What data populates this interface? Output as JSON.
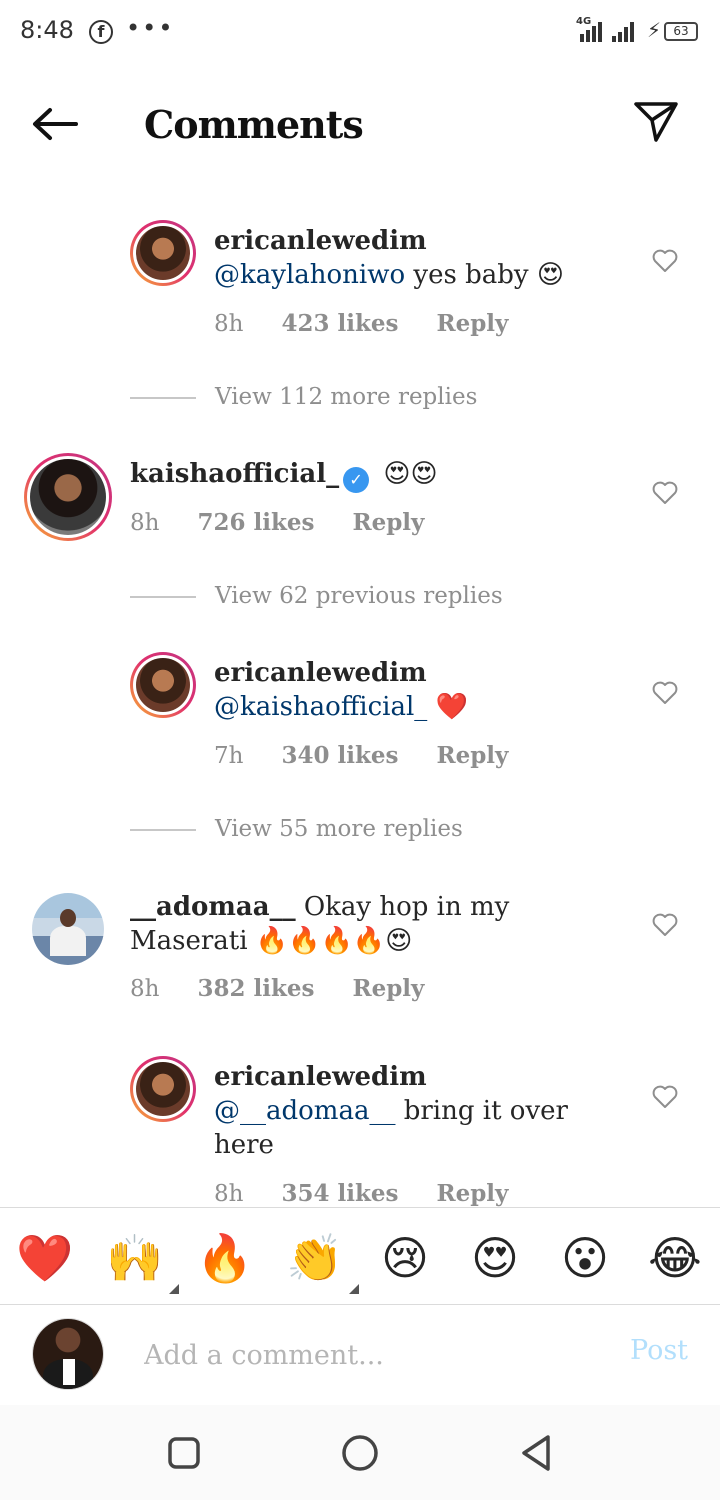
{
  "status_bar": {
    "time": "8:48",
    "network": "4G",
    "battery": "63"
  },
  "header": {
    "title": "Comments"
  },
  "comments": [
    {
      "user": "ericanlewedim",
      "mention": "@kaylahoniwo",
      "text": "yes baby",
      "emoji": "😍",
      "time": "8h",
      "likes": "423 likes",
      "reply": "Reply"
    },
    {
      "view_more": "View 112 more replies"
    },
    {
      "user": "kaishaofficial_",
      "text": "😍😍",
      "time": "8h",
      "likes": "726 likes",
      "reply": "Reply"
    },
    {
      "view_more": "View 62 previous replies"
    },
    {
      "user": "ericanlewedim",
      "mention": "@kaishaofficial_",
      "emoji": "❤️",
      "time": "7h",
      "likes": "340 likes",
      "reply": "Reply"
    },
    {
      "view_more": "View 55 more replies"
    },
    {
      "user": "__adomaa__",
      "text_line1": "Okay hop in my",
      "text_line2": "Maserati",
      "emoji": "🔥🔥🔥🔥😍",
      "time": "8h",
      "likes": "382 likes",
      "reply": "Reply"
    },
    {
      "user": "ericanlewedim",
      "mention": "@__adomaa__",
      "text_line1": "bring it over",
      "text_line2": "here",
      "time": "8h",
      "likes": "354 likes",
      "reply": "Reply"
    }
  ],
  "reactions": [
    "❤️",
    "🙌",
    "🔥",
    "👏",
    "😢",
    "😍",
    "😮",
    "😂"
  ],
  "composer": {
    "placeholder": "Add a comment...",
    "post_label": "Post"
  },
  "colors": {
    "mention": "#00376b",
    "meta": "#8e8e8e",
    "post": "#b2dffc",
    "verified": "#3897f0"
  }
}
